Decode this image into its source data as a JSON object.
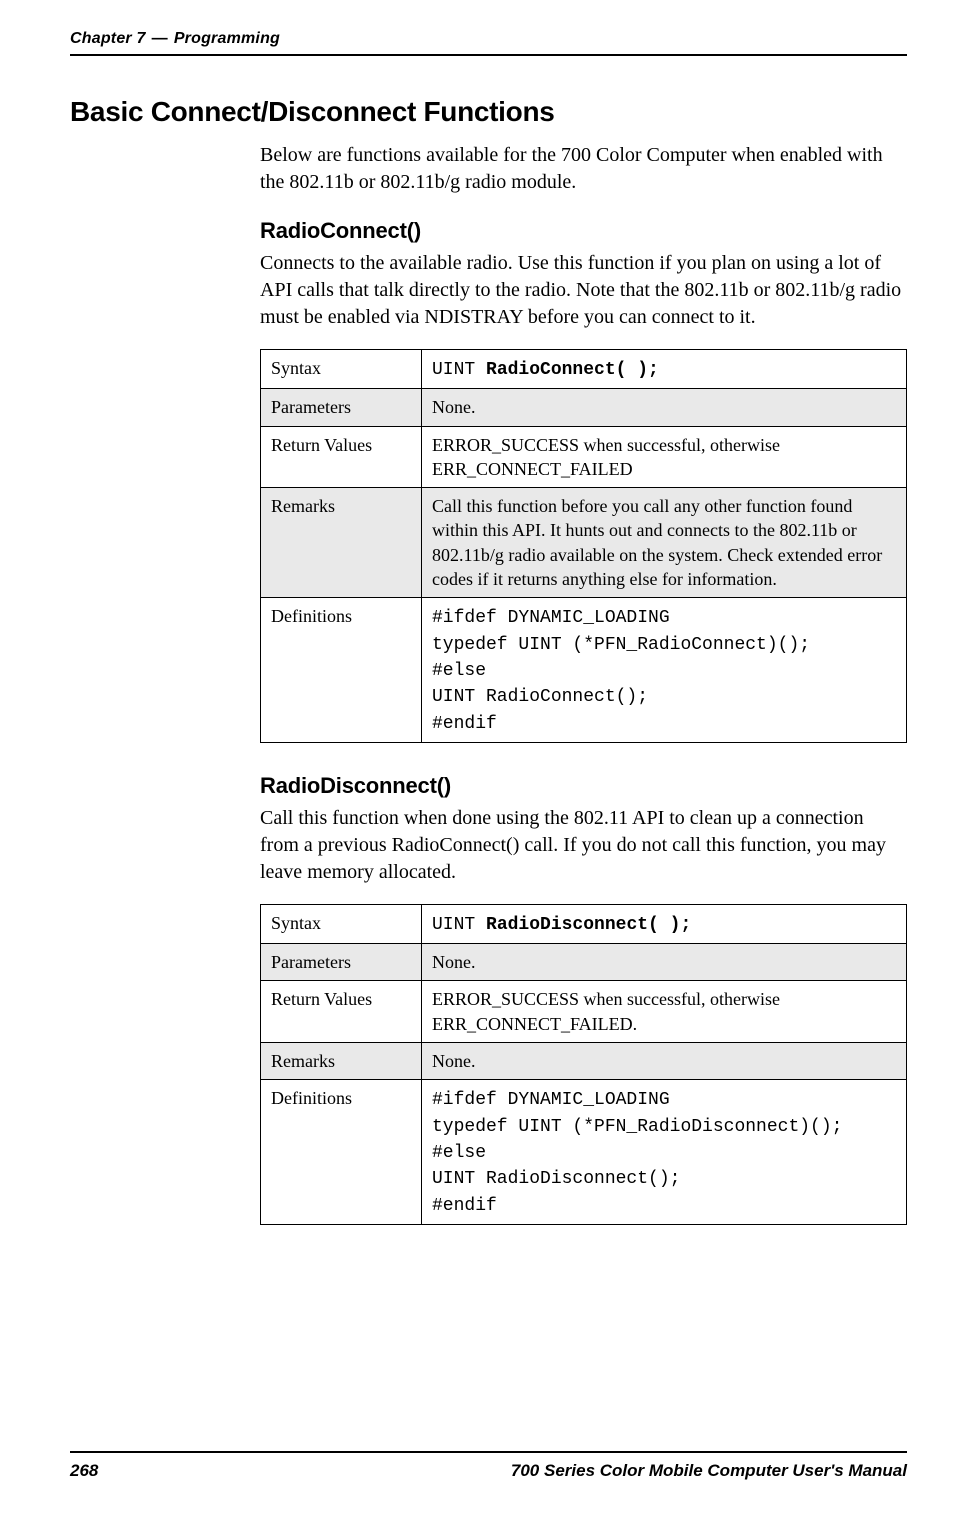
{
  "header": {
    "chapter": "Chapter 7",
    "dash": "—",
    "title": "Programming"
  },
  "section": {
    "title": "Basic Connect/Disconnect Functions",
    "intro": "Below are functions available for the 700 Color Computer when enabled with the 802.11b or 802.11b/g radio module."
  },
  "radioConnect": {
    "title": "RadioConnect()",
    "desc": "Connects to the available radio. Use this function if you plan on using a lot of API calls that talk directly to the radio. Note that the 802.11b or 802.11b/g radio must be enabled via NDISTRAY before you can connect to it.",
    "rows": {
      "syntaxLabel": "Syntax",
      "syntaxPrefix": "UINT ",
      "syntaxCode": "RadioConnect( );",
      "paramsLabel": "Parameters",
      "paramsVal": "None.",
      "rvLabel": "Return Values",
      "rvVal": "ERROR_SUCCESS when successful, otherwise ERR_CONNECT_FAILED",
      "remarksLabel": "Remarks",
      "remarksVal": "Call this function before you call any other function found within this API. It hunts out and connects to the 802.11b or 802.11b/g radio available on the system. Check extended error codes if it returns anything else for information.",
      "defsLabel": "Definitions",
      "defsCode": "#ifdef DYNAMIC_LOADING\ntypedef UINT (*PFN_RadioConnect)();\n#else\nUINT RadioConnect();\n#endif"
    }
  },
  "radioDisconnect": {
    "title": "RadioDisconnect()",
    "desc": "Call this function when done using the 802.11 API to clean up a connection from a previous RadioConnect() call. If you do not call this function, you may leave memory allocated.",
    "rows": {
      "syntaxLabel": "Syntax",
      "syntaxPrefix": "UINT ",
      "syntaxCode": "RadioDisconnect( );",
      "paramsLabel": "Parameters",
      "paramsVal": "None.",
      "rvLabel": "Return Values",
      "rvVal": "ERROR_SUCCESS when successful, otherwise ERR_CONNECT_FAILED.",
      "remarksLabel": "Remarks",
      "remarksVal": "None.",
      "defsLabel": "Definitions",
      "defsCode": "#ifdef DYNAMIC_LOADING\ntypedef UINT (*PFN_RadioDisconnect)();\n#else\nUINT RadioDisconnect();\n#endif"
    }
  },
  "footer": {
    "pageNum": "268",
    "manual": "700 Series Color Mobile Computer User's Manual"
  }
}
